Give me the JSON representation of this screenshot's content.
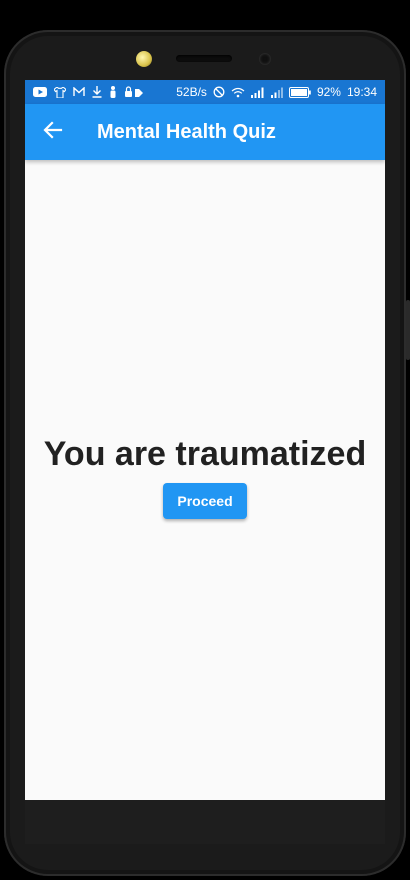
{
  "status_bar": {
    "net_speed": "52B/s",
    "battery_percent": "92%",
    "time": "19:34",
    "left_icons": [
      "youtube-icon",
      "shirt-icon",
      "gmail-icon",
      "download-icon",
      "figure-icon",
      "vpn-icon"
    ],
    "right_icons": [
      "alarm-off-icon",
      "wifi-icon",
      "signal-icon",
      "signal-2-icon",
      "battery-icon"
    ]
  },
  "app_bar": {
    "title": "Mental Health Quiz",
    "back_icon": "arrow-back-icon"
  },
  "main": {
    "result_text": "You are traumatized",
    "proceed_label": "Proceed"
  },
  "colors": {
    "status_bar": "#1976d2",
    "app_bar": "#2196f3",
    "button": "#2196f3",
    "background": "#fafafa",
    "text": "#212121"
  }
}
